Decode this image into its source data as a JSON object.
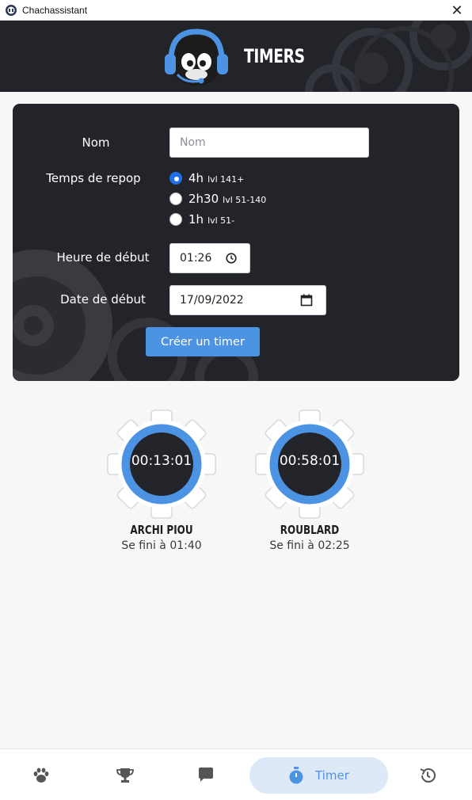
{
  "window": {
    "title": "Chachassistant",
    "close_icon": "close-icon"
  },
  "header": {
    "title": "TIMERS",
    "logo_icon": "mascot-headset-logo"
  },
  "form": {
    "name_label": "Nom",
    "name_placeholder": "Nom",
    "repop_label": "Temps de repop",
    "repop_options": [
      {
        "main": "4h",
        "sub": "lvl 141+",
        "checked": true
      },
      {
        "main": "2h30",
        "sub": "lvl 51-140",
        "checked": false
      },
      {
        "main": "1h",
        "sub": "lvl 51-",
        "checked": false
      }
    ],
    "start_time_label": "Heure de début",
    "start_time_value": "01:26",
    "start_date_label": "Date de début",
    "start_date_value": "17/09/2022",
    "submit_label": "Créer un timer"
  },
  "timers": [
    {
      "remaining": "00:13:01",
      "name": "ARCHI PIOU",
      "end_text": "Se fini à 01:40",
      "progress": 0.95
    },
    {
      "remaining": "00:58:01",
      "name": "ROUBLARD",
      "end_text": "Se fini à 02:25",
      "progress": 0.99
    }
  ],
  "bottom_nav": {
    "items": [
      {
        "icon": "paw-icon",
        "label": ""
      },
      {
        "icon": "trophy-icon",
        "label": ""
      },
      {
        "icon": "chat-icon",
        "label": ""
      },
      {
        "icon": "stopwatch-icon",
        "label": "Timer",
        "active": true
      },
      {
        "icon": "history-icon",
        "label": ""
      }
    ]
  },
  "colors": {
    "accent": "#4d93e3",
    "dark": "#23242a",
    "radio_checked": "#1f6feb",
    "active_nav_bg": "#dde9f7"
  }
}
